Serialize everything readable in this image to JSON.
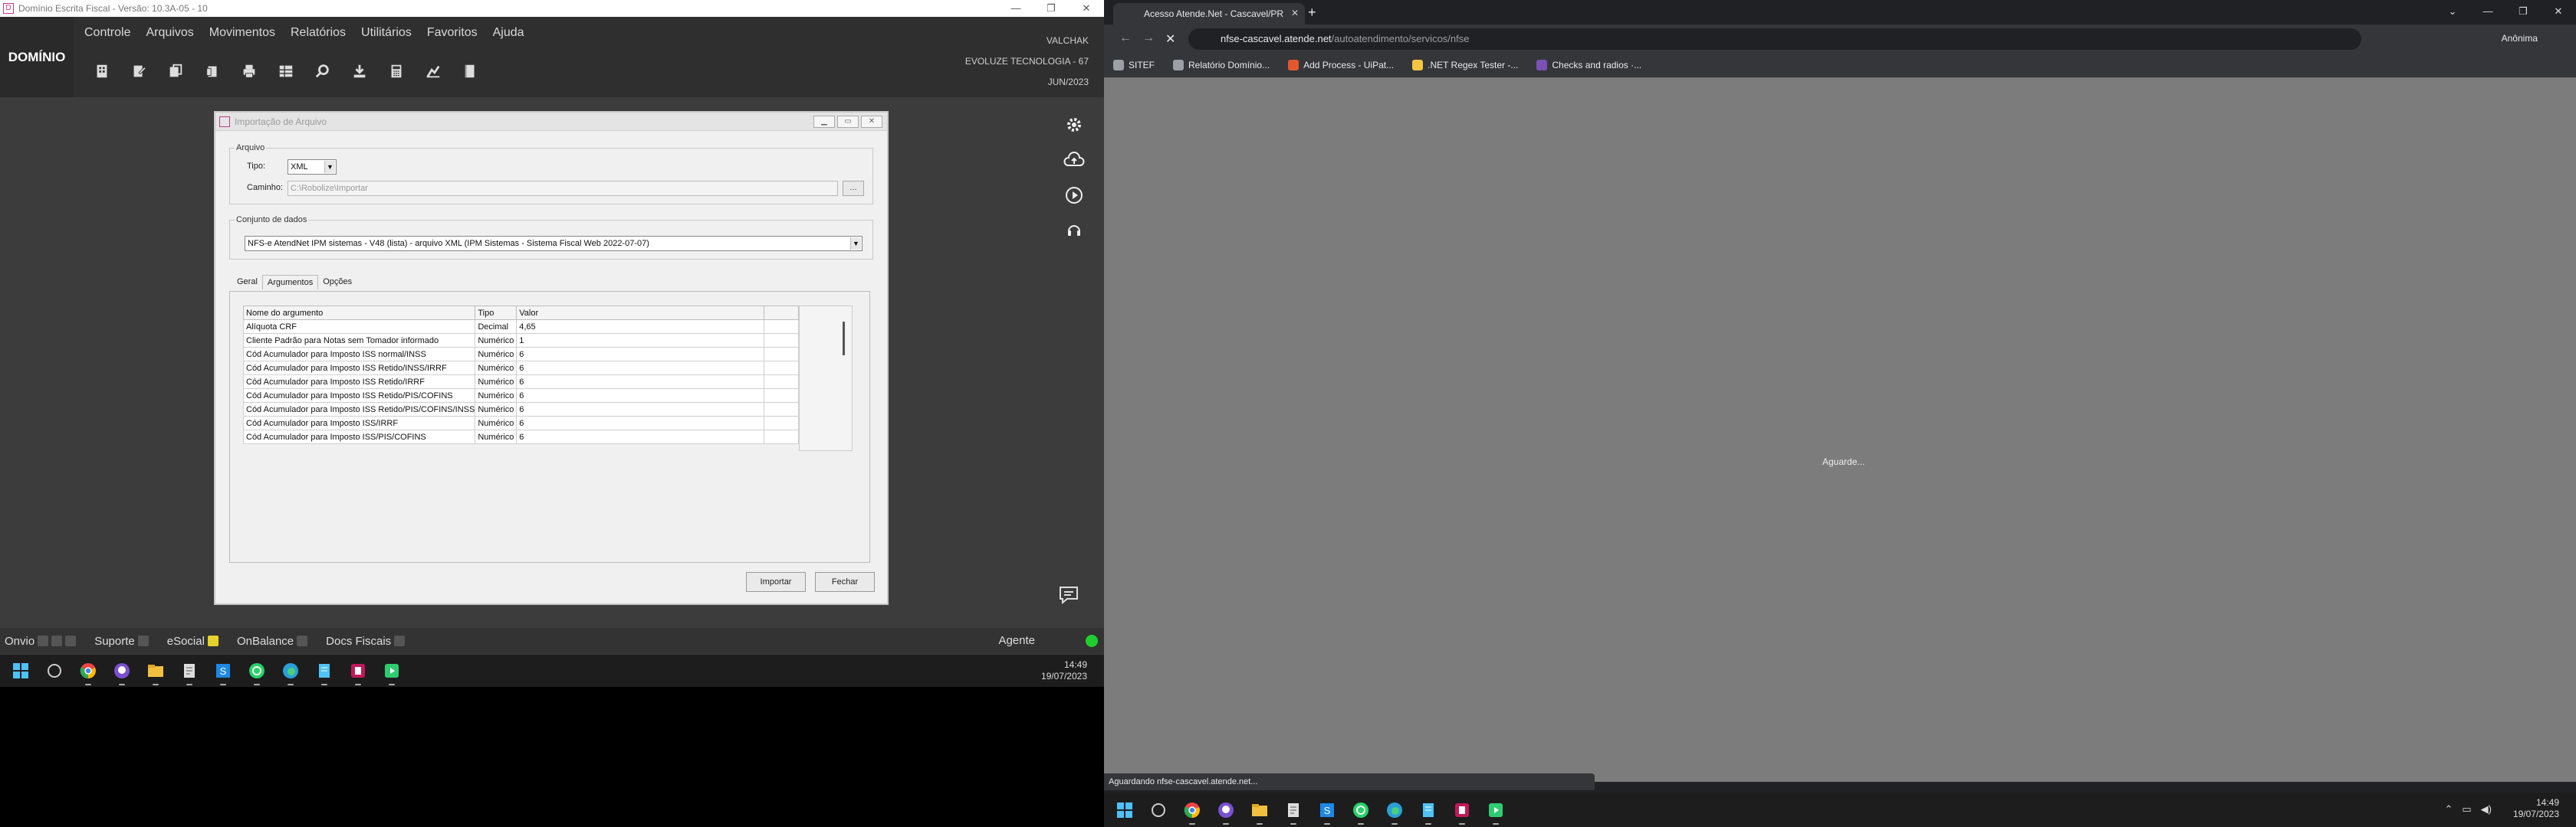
{
  "left": {
    "window_title": "Domínio Escrita Fiscal - Versão: 10.3A-05 - 10",
    "logo": "DOMÍNIO",
    "menu": [
      "Controle",
      "Arquivos",
      "Movimentos",
      "Relatórios",
      "Utilitários",
      "Favoritos",
      "Ajuda"
    ],
    "toolbar_icons": [
      "building-icon",
      "document-edit-icon",
      "copy-icon",
      "files-icon",
      "printer-icon",
      "grid-icon",
      "search-icon",
      "download-icon",
      "calculator-icon",
      "chart-icon",
      "book-icon"
    ],
    "company": {
      "user": "VALCHAK",
      "name": "EVOLUZE TECNOLOGIA",
      "code": "67",
      "period": "JUN/2023"
    },
    "dialog": {
      "title": "Importação de Arquivo",
      "arquivo_legend": "Arquivo",
      "tipo_label": "Tipo:",
      "tipo_value": "XML",
      "caminho_label": "Caminho:",
      "caminho_value": "C:\\Robolize\\Importar",
      "browse_label": "...",
      "conjunto_legend": "Conjunto de dados",
      "conjunto_value": "NFS-e  AtendNet IPM sistemas - V48 (lista) - arquivo XML  (IPM Sistemas - Sistema Fiscal Web 2022-07-07)",
      "tabs": [
        "Geral",
        "Argumentos",
        "Opções"
      ],
      "active_tab": "Argumentos",
      "columns": [
        "Nome do argumento",
        "Tipo",
        "Valor"
      ],
      "rows": [
        {
          "nome": "Alíquota CRF",
          "tipo": "Decimal",
          "valor": "4,65"
        },
        {
          "nome": "Cliente Padrão para Notas sem Tomador informado",
          "tipo": "Numérico",
          "valor": "1"
        },
        {
          "nome": "Cód Acumulador para Imposto ISS normal/INSS",
          "tipo": "Numérico",
          "valor": "6"
        },
        {
          "nome": "Cód Acumulador para Imposto ISS Retido/INSS/IRRF",
          "tipo": "Numérico",
          "valor": "6"
        },
        {
          "nome": "Cód Acumulador para Imposto ISS Retido/IRRF",
          "tipo": "Numérico",
          "valor": "6"
        },
        {
          "nome": "Cód Acumulador para Imposto ISS Retido/PIS/COFINS",
          "tipo": "Numérico",
          "valor": "6"
        },
        {
          "nome": "Cód Acumulador para Imposto ISS Retido/PIS/COFINS/INSS",
          "tipo": "Numérico",
          "valor": "6"
        },
        {
          "nome": "Cód Acumulador para Imposto ISS/IRRF",
          "tipo": "Numérico",
          "valor": "6"
        },
        {
          "nome": "Cód Acumulador para Imposto ISS/PIS/COFINS",
          "tipo": "Numérico",
          "valor": "6"
        }
      ],
      "import_button": "Importar",
      "close_button": "Fechar"
    },
    "status_items": [
      "Onvio",
      "Suporte",
      "eSocial",
      "OnBalance",
      "Docs Fiscais"
    ],
    "agente": "Agente",
    "clock_time": "14:49",
    "clock_date": "19/07/2023"
  },
  "right": {
    "tab_title": "Acesso Atende.Net - Cascavel/PR",
    "url_host": "nfse-cascavel.atende.net",
    "url_path": "/autoatendimento/servicos/nfse",
    "profile": "Anônima",
    "bookmarks": [
      {
        "label": "SITEF",
        "color": "#9aa0a6"
      },
      {
        "label": "Relatório Domínio...",
        "color": "#9aa0a6"
      },
      {
        "label": "Add Process - UiPat...",
        "color": "#e4572e"
      },
      {
        "label": ".NET Regex Tester -...",
        "color": "#f4c542"
      },
      {
        "label": "Checks and radios ·...",
        "color": "#7952b3"
      }
    ],
    "loading_text": "Aguarde...",
    "status_text": "Aguardando nfse-cascavel.atende.net...",
    "clock_time": "14:49",
    "clock_date": "19/07/2023"
  }
}
